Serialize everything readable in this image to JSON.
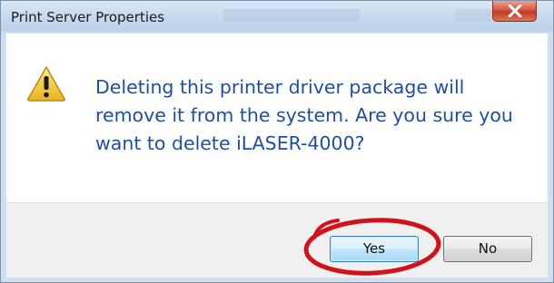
{
  "window": {
    "title": "Print Server Properties",
    "close_icon": "close-x-icon"
  },
  "dialog": {
    "icon": "warning-triangle-icon",
    "message": "Deleting this printer driver package will remove it from the system. Are you sure you want to delete iLASER-4000?"
  },
  "buttons": {
    "yes_label": "Yes",
    "no_label": "No"
  },
  "annotation": {
    "type": "circle",
    "target": "yes-button",
    "color": "#d0121b"
  },
  "colors": {
    "message_text": "#1f4f9c",
    "titlebar": "#c7d9ee",
    "close_button": "#c23b22",
    "warning_icon": "#f2c230"
  }
}
